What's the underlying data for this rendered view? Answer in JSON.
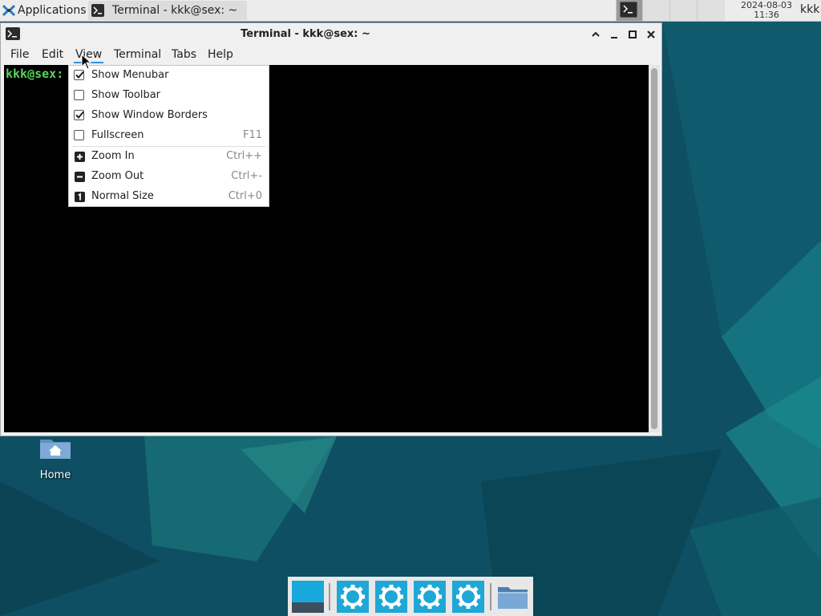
{
  "top_panel": {
    "applications_label": "Applications",
    "task_title": "Terminal - kkk@sex: ~",
    "clock_date": "2024-08-03",
    "clock_time": "11:36",
    "user": "kkk"
  },
  "window": {
    "title": "Terminal - kkk@sex: ~",
    "menubar": [
      "File",
      "Edit",
      "View",
      "Terminal",
      "Tabs",
      "Help"
    ],
    "open_menu": "View",
    "prompt": "kkk@sex:"
  },
  "view_menu": {
    "items": [
      {
        "label": "Show Menubar",
        "checked": true,
        "accel": ""
      },
      {
        "label": "Show Toolbar",
        "checked": false,
        "accel": ""
      },
      {
        "label": "Show Window Borders",
        "checked": true,
        "accel": ""
      },
      {
        "label": "Fullscreen",
        "checked": false,
        "accel": "F11"
      },
      {
        "label": "Zoom In",
        "icon": "zoom-in-icon",
        "accel": "Ctrl++"
      },
      {
        "label": "Zoom Out",
        "icon": "zoom-out-icon",
        "accel": "Ctrl+-"
      },
      {
        "label": "Normal Size",
        "icon": "normal-size-icon",
        "accel": "Ctrl+0"
      }
    ]
  },
  "desktop": {
    "home_label": "Home"
  },
  "colors": {
    "desktop_bg": "#0e4f63",
    "prompt_green": "#58d35a",
    "accent_blue": "#3d8fd1",
    "dock_icon": "#1fa7d6"
  }
}
